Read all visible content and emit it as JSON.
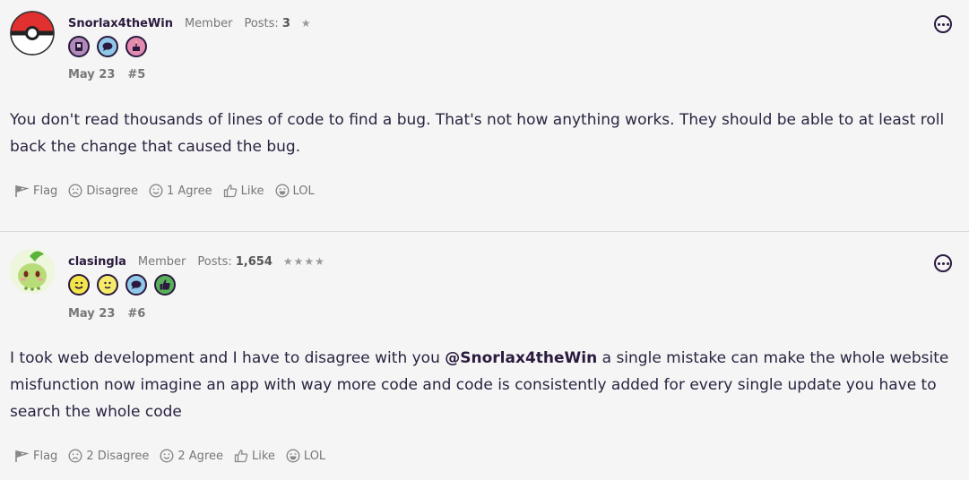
{
  "posts": [
    {
      "username": "Snorlax4theWin",
      "role": "Member",
      "posts_label": "Posts:",
      "posts_count": "3",
      "stars": "★",
      "badges": [
        "notebook-badge",
        "comment-badge",
        "cake-badge"
      ],
      "date": "May 23",
      "number": "#5",
      "text": "You don't read thousands of lines of code to find a bug. That's not how anything works. They should be able to at least roll back the change that caused the bug.",
      "reactions": {
        "flag": "Flag",
        "disagree": "Disagree",
        "agree": "1 Agree",
        "like": "Like",
        "lol": "LOL"
      }
    },
    {
      "username": "clasingla",
      "role": "Member",
      "posts_label": "Posts:",
      "posts_count": "1,654",
      "stars": "★★★★",
      "badges": [
        "wink-badge",
        "smile-badge",
        "comment-badge",
        "thumbs-up-badge"
      ],
      "date": "May 23",
      "number": "#6",
      "text_before": "I took web development and I have to disagree with you ",
      "mention": "@Snorlax4theWin",
      "text_after": " a single mistake can make the whole website misfunction now imagine an app with way more code and code is consistently added for every single update you have to search the whole code",
      "reactions": {
        "flag": "Flag",
        "disagree": "2 Disagree",
        "agree": "2 Agree",
        "like": "Like",
        "lol": "LOL"
      }
    }
  ],
  "colors": {
    "text": "#2b2340",
    "muted": "#777777",
    "accent": "#2b1a3e",
    "background": "#f5f5f5"
  }
}
